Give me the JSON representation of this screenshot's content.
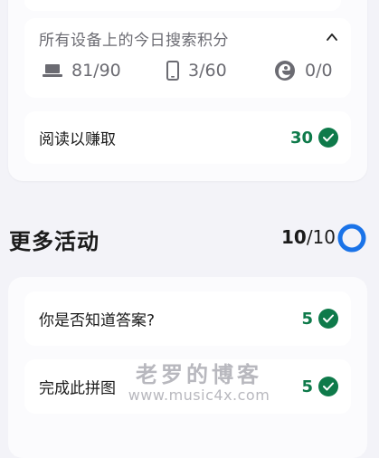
{
  "points_breakdown": {
    "title": "所有设备上的今日搜索积分",
    "pc": {
      "icon": "laptop-icon",
      "value": "81/90"
    },
    "mobile": {
      "icon": "phone-icon",
      "value": "3/60"
    },
    "edge": {
      "icon": "edge-browser-icon",
      "value": "0/0"
    }
  },
  "read_to_earn": {
    "label": "阅读以赚取",
    "points": "30"
  },
  "more_activities": {
    "title": "更多活动",
    "completed": "10",
    "total": "/10",
    "progress_fraction": 1.0,
    "items": [
      {
        "label": "你是否知道答案?",
        "points": "5"
      },
      {
        "label": "完成此拼图",
        "points": "5"
      }
    ]
  },
  "watermark": {
    "text": "老罗的博客",
    "url": "www.music4x.com"
  },
  "colors": {
    "accent_green": "#0e7a4a",
    "progress_blue": "#1a73e8",
    "page_bg": "#f3f3f8"
  }
}
